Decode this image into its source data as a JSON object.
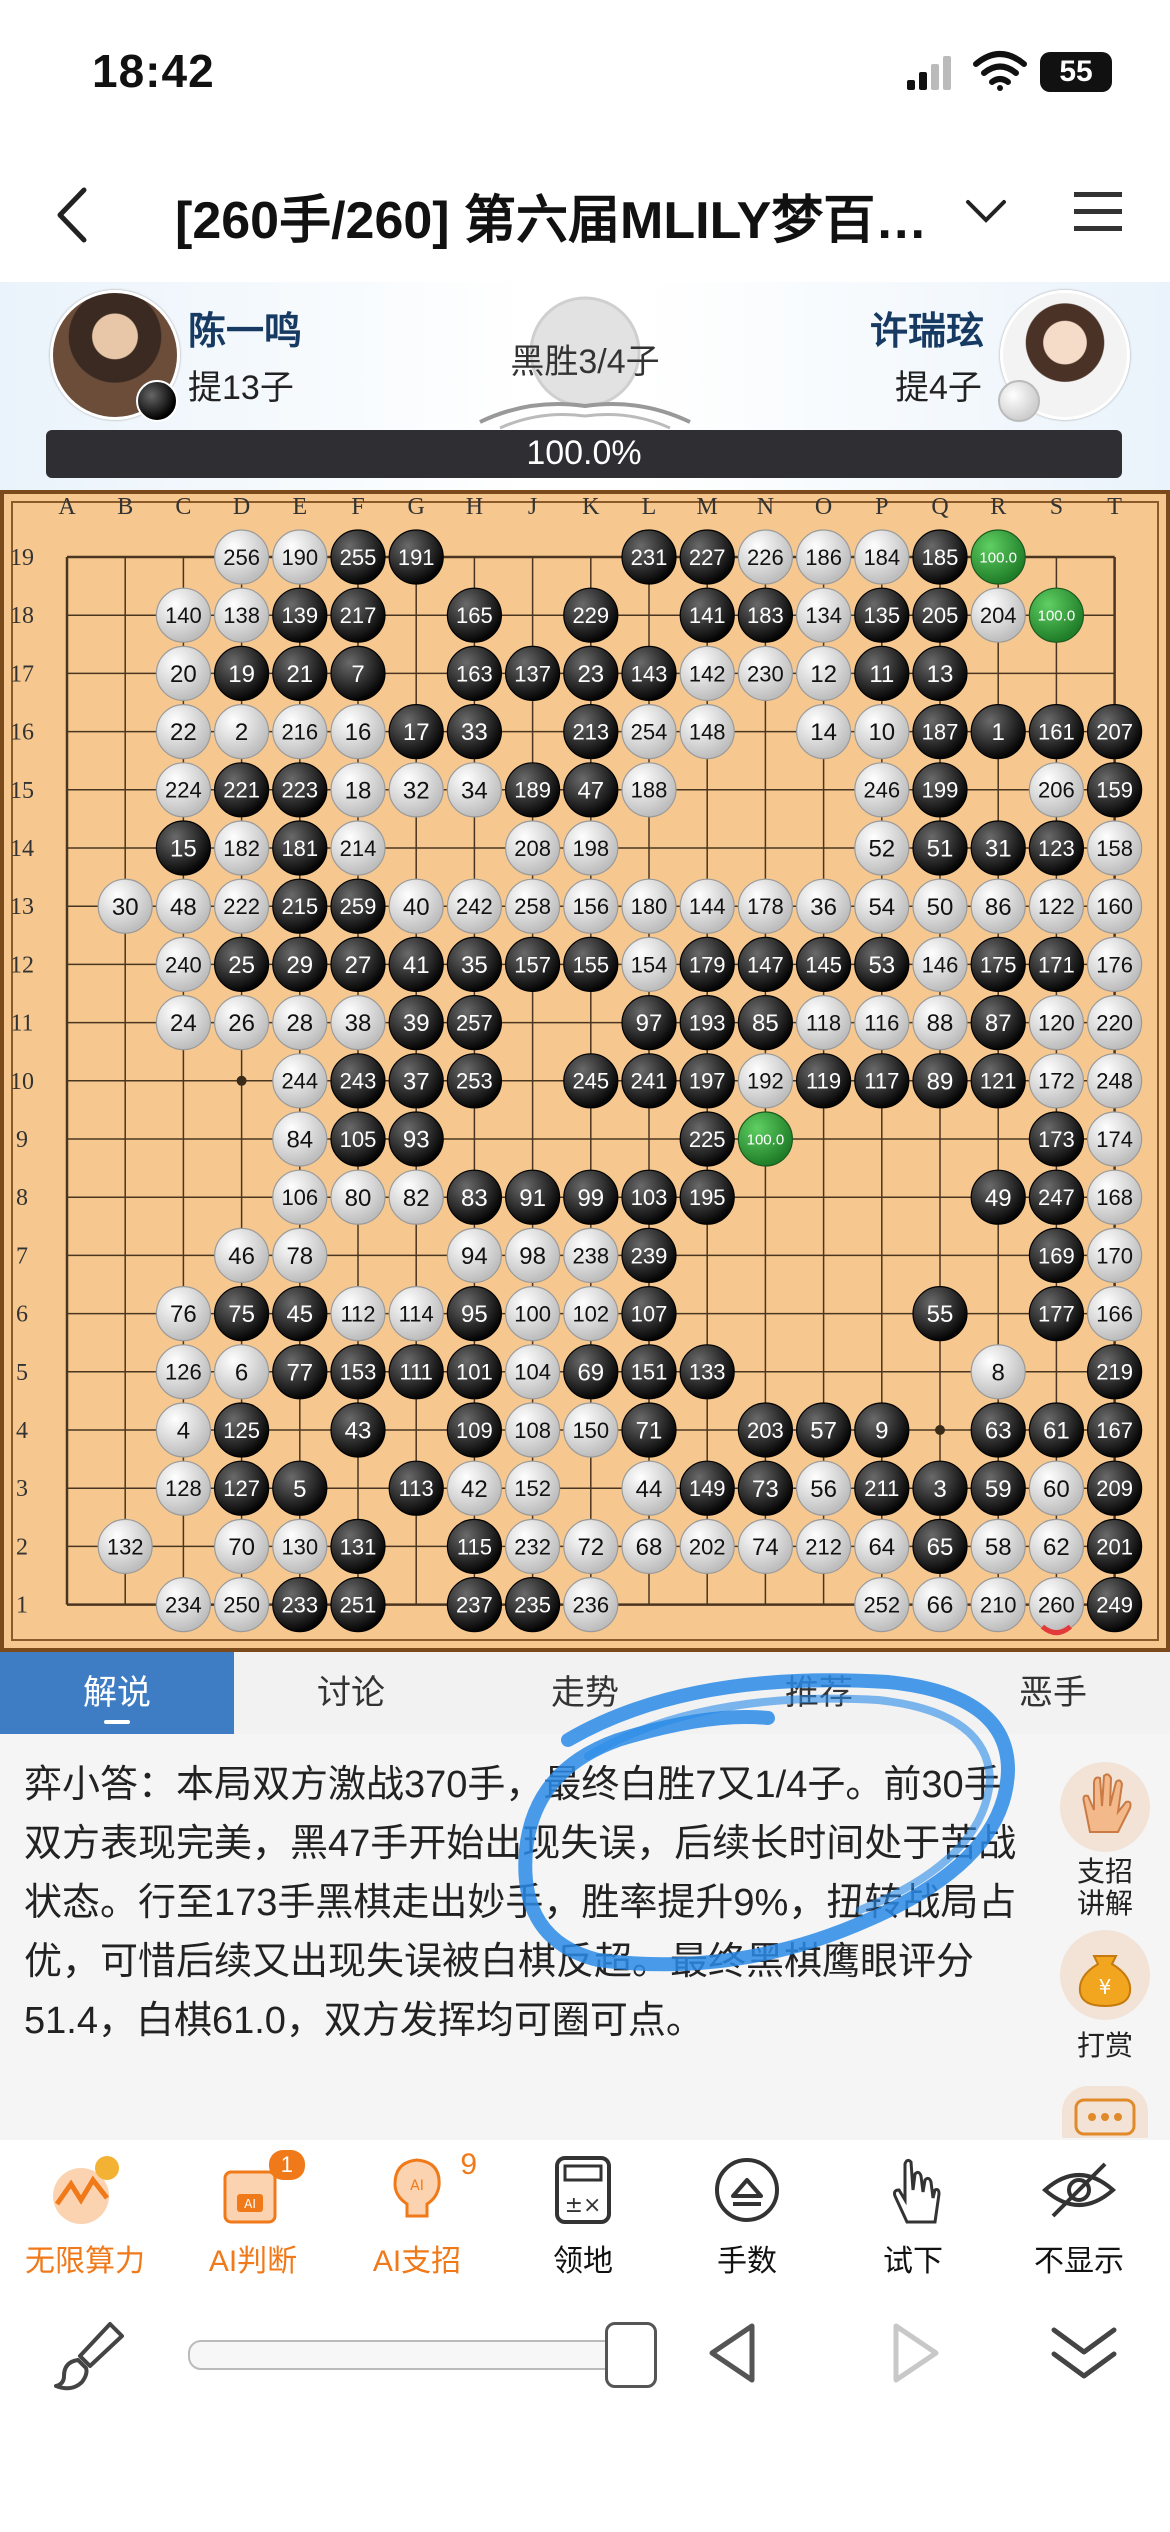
{
  "status_bar": {
    "time": "18:42",
    "battery": "55"
  },
  "header": {
    "title": "[260手/260] 第六届MLILY梦百…"
  },
  "players": {
    "black": {
      "name": "陈一鸣",
      "captures": "提13子"
    },
    "white": {
      "name": "许瑞玹",
      "captures": "提4子"
    },
    "result": "黑胜3/4子",
    "win_rate": "100.0%"
  },
  "board": {
    "columns": [
      "A",
      "B",
      "C",
      "D",
      "E",
      "F",
      "G",
      "H",
      "J",
      "K",
      "L",
      "M",
      "N",
      "O",
      "P",
      "Q",
      "R",
      "S",
      "T"
    ],
    "rows": [
      "19",
      "18",
      "17",
      "16",
      "15",
      "14",
      "13",
      "12",
      "11",
      "10",
      "9",
      "8",
      "7",
      "6",
      "5",
      "4",
      "3",
      "2",
      "1"
    ],
    "rows_data": [
      ". . . w256 w190 b255 b191 . . . b231 b227 w226 w186 w184 b185 g100.0 . .",
      ". . w140 w138 b139 b217 . b165 . b229 . b141 b183 w134 b135 b205 w204 g100.0 .",
      ". . w20 b19 b21 b7 . b163 b137 b23 b143 w142 w230 w12 b11 b13 . . .",
      ". . w22 w2 w216 w16 b17 b33 . b213 w254 w148 . w14 w10 b187 b1 b161 b207",
      ". . w224 b221 b223 w18 w32 w34 b189 b47 w188 . . . w246 b199 . w206 b159",
      ". . b15 w182 b181 w214 . . w208 w198 . . . . w52 b51 b31 b123 w158",
      ". w30 w48 w222 b215 b259 w40 w242 w258 w156 w180 w144 w178 w36 w54 w50 w86 w122 w160",
      ". . w240 b25 b29 b27 b41 b35 b157 b155 w154 b179 b147 b145 b53 w146 b175 b171 w176",
      ". . w24 w26 w28 w38 b39 b257 . . b97 b193 b85 w118 w116 w88 b87 w120 w220",
      ". . . . w244 b243 b37 b253 . b245 b241 b197 w192 b119 b117 b89 b121 w172 w248",
      ". . . . w84 b105 b93 . . . . b225 g100.0 . . . . b173 w174",
      ". . . . w106 w80 w82 b83 b91 b99 b103 b195 . . . . b49 b247 w168",
      ". . . w46 w78 . . w94 w98 w238 b239 . . . . . . b169 w170",
      ". . w76 b75 b45 w112 w114 b95 w100 w102 b107 . . . . b55 . b177 w166",
      ". . w126 w6 b77 b153 b111 b101 w104 b69 b151 b133 . . . . w8 . b219",
      ". . w4 b125 . b43 . b109 w108 w150 b71 . b203 b57 b9 . b63 b61 b167",
      ". . w128 b127 b5 . b113 w42 w152 . w44 b149 b73 w56 b211 b3 b59 w60 b209",
      ". w132 . w70 w130 b131 . b115 w232 w72 w68 w202 w74 w212 w64 b65 w58 w62 b201",
      ". . w234 w250 b233 b251 . b237 b235 w236 . . . . w252 w66 w210 w260 b249"
    ],
    "last_move": "260"
  },
  "tabs": [
    "解说",
    "讨论",
    "走势",
    "推荐",
    "恶手"
  ],
  "commentary": {
    "text": "弈小答：本局双方激战370手，最终白胜7又1/4子。前30手双方表现完美，黑47手开始出现失误，后续长时间处于苦战状态。行至173手黑棋走出妙手，胜率提升9%，扭转战局占优，可惜后续又出现失误被白棋反超。最终黑棋鹰眼评分51.4，白棋61.0，双方发挥均可圈可点。",
    "side_buttons": [
      {
        "label": "支招\n讲解",
        "icon": "hand-icon"
      },
      {
        "label": "打赏",
        "icon": "money-bag-icon"
      }
    ]
  },
  "toolbar": {
    "items": [
      {
        "label": "无限算力",
        "icon": "infinite-compute-icon"
      },
      {
        "label": "AI判断",
        "icon": "ai-judge-icon",
        "badge": "1"
      },
      {
        "label": "AI支招",
        "icon": "ai-hint-icon",
        "badge": "9"
      },
      {
        "label": "领地",
        "icon": "territory-icon"
      },
      {
        "label": "手数",
        "icon": "move-number-icon"
      },
      {
        "label": "试下",
        "icon": "try-move-icon"
      },
      {
        "label": "不显示",
        "icon": "hide-icon"
      }
    ]
  },
  "colors": {
    "accent_blue": "#3e7cc4",
    "orange": "#f07a1a",
    "board": "#f7c98c",
    "highlight_green": "#2e9b3a"
  }
}
